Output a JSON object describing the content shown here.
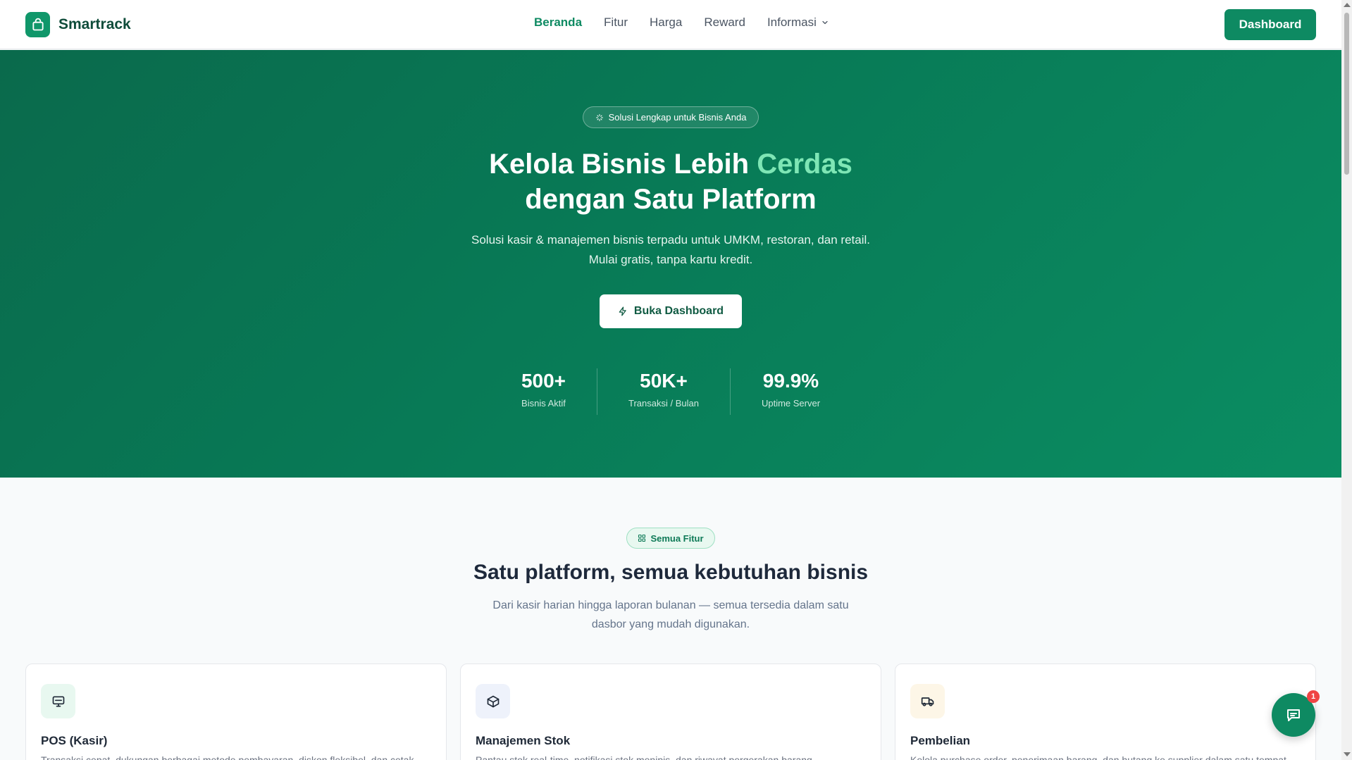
{
  "navbar": {
    "brand": "Smartrack",
    "links": [
      {
        "label": "Beranda",
        "active": true
      },
      {
        "label": "Fitur"
      },
      {
        "label": "Harga"
      },
      {
        "label": "Reward"
      },
      {
        "label": "Informasi"
      }
    ],
    "dashboard_label": "Dashboard"
  },
  "hero": {
    "pill": "Solusi Lengkap untuk Bisnis Anda",
    "title_part1": "Kelola Bisnis Lebih ",
    "title_accent": "Cerdas",
    "title_line2": "dengan Satu Platform",
    "subtitle_line1": "Solusi kasir & manajemen bisnis terpadu untuk UMKM, restoran, dan retail.",
    "subtitle_line2": "Mulai gratis, tanpa kartu kredit.",
    "cta_label": "Buka Dashboard",
    "stats": [
      {
        "value": "500+",
        "label": "Bisnis Aktif"
      },
      {
        "value": "50K+",
        "label": "Transaksi / Bulan"
      },
      {
        "value": "99.9%",
        "label": "Uptime Server"
      }
    ]
  },
  "features": {
    "pill": "Semua Fitur",
    "title": "Satu platform, semua kebutuhan bisnis",
    "subtitle_line1": "Dari kasir harian hingga laporan bulanan — semua tersedia dalam satu",
    "subtitle_line2": "dasbor yang mudah digunakan.",
    "cards": [
      {
        "title": "POS (Kasir)",
        "desc": "Transaksi cepat, dukungan berbagai metode pembayaran, diskon fleksibel, dan cetak",
        "icon": "monitor-icon"
      },
      {
        "title": "Manajemen Stok",
        "desc": "Pantau stok real-time, notifikasi stok menipis, dan riwayat pergerakan barang.",
        "icon": "box-icon"
      },
      {
        "title": "Pembelian",
        "desc": "Kelola purchase order, penerimaan barang, dan hutang ke supplier dalam satu tempat.",
        "icon": "truck-icon"
      }
    ]
  },
  "chat": {
    "badge": "1"
  },
  "colors": {
    "brand": "#0e8a62",
    "hero_start": "#0a6a4c",
    "hero_end": "#0b8d62",
    "accent": "#7ee6b5"
  }
}
